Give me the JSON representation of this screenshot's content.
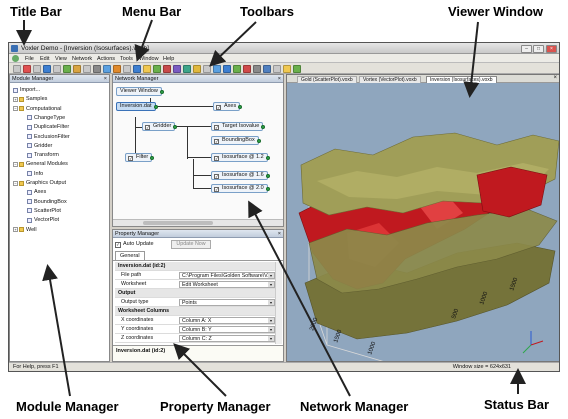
{
  "annotations": {
    "title_bar": "Title Bar",
    "menu_bar": "Menu Bar",
    "toolbars": "Toolbars",
    "viewer_window": "Viewer Window",
    "module_manager": "Module Manager",
    "property_manager": "Property Manager",
    "network_manager": "Network Manager",
    "status_bar": "Status Bar"
  },
  "window": {
    "title": "Voxler Demo - [Inversion (Isosurfaces).voxb]",
    "controls": [
      "–",
      "□",
      "×"
    ]
  },
  "menu": [
    "File",
    "Edit",
    "View",
    "Network",
    "Actions",
    "Tools",
    "Window",
    "Help"
  ],
  "toolbar_colors": [
    "#c8c8c8",
    "#e05050",
    "#c8c8c8",
    "#3d7fd1",
    "#c8c8c8",
    "#6ab04c",
    "#d9a441",
    "#c8c8c8",
    "#8a8a8a",
    "#5aa0e0",
    "#e08a2b",
    "#c8c8c8",
    "#3d7fd1",
    "#f0c850",
    "#6ab04c",
    "#c84a4a",
    "#7a5bc2",
    "#3da58a",
    "#e0b83d",
    "#c8c8c8",
    "#5aa0e0",
    "#3d7fd1",
    "#6ab04c",
    "#d04a4a",
    "#8a8a8a",
    "#5080c0",
    "#c8c8c8",
    "#f0c850",
    "#6ab04c"
  ],
  "module_manager": {
    "title": "Module Manager",
    "items": [
      {
        "label": "Import...",
        "level": 0,
        "kind": "doc"
      },
      {
        "label": "Samples",
        "level": 0,
        "kind": "folder",
        "exp": "+"
      },
      {
        "label": "Computational",
        "level": 0,
        "kind": "folder",
        "exp": "−"
      },
      {
        "label": "ChangeType",
        "level": 1,
        "kind": "doc"
      },
      {
        "label": "DuplicateFilter",
        "level": 1,
        "kind": "doc"
      },
      {
        "label": "ExclusionFilter",
        "level": 1,
        "kind": "doc"
      },
      {
        "label": "Gridder",
        "level": 1,
        "kind": "doc"
      },
      {
        "label": "Transform",
        "level": 1,
        "kind": "doc"
      },
      {
        "label": "General Modules",
        "level": 0,
        "kind": "folder",
        "exp": "−"
      },
      {
        "label": "Info",
        "level": 1,
        "kind": "doc"
      },
      {
        "label": "Graphics Output",
        "level": 0,
        "kind": "folder",
        "exp": "−"
      },
      {
        "label": "Axes",
        "level": 1,
        "kind": "doc"
      },
      {
        "label": "BoundingBox",
        "level": 1,
        "kind": "doc"
      },
      {
        "label": "ScatterPlot",
        "level": 1,
        "kind": "doc"
      },
      {
        "label": "VectorPlot",
        "level": 1,
        "kind": "doc"
      },
      {
        "label": "Well",
        "level": 0,
        "kind": "folder",
        "exp": "+"
      }
    ]
  },
  "network_manager": {
    "title": "Network Manager",
    "nodes": {
      "viewer": "Viewer Window",
      "inversion": "Inversion.dat",
      "axes": "Axes",
      "gridder": "Gridder",
      "target": "Target Isovalue",
      "bbox": "BoundingBox",
      "filter": "Filter",
      "iso12": "Isosurface @ 1.2",
      "iso16": "Isosurface @ 1.6",
      "iso20": "Isosurface @ 2.0"
    }
  },
  "property_manager": {
    "title": "Property Manager",
    "auto_update": "Auto Update",
    "update_now": "Update Now",
    "tab": "General",
    "rows": [
      {
        "type": "section",
        "key": "Inversion.dat (id:2)"
      },
      {
        "type": "field",
        "key": "File path",
        "value": "C:\\Program Files\\Golden Software\\V..."
      },
      {
        "type": "field",
        "key": "Worksheet",
        "value": "Edit Worksheet"
      },
      {
        "type": "section",
        "key": "Output"
      },
      {
        "type": "field",
        "key": "Output type",
        "value": "Points"
      },
      {
        "type": "section",
        "key": "Worksheet Columns"
      },
      {
        "type": "field",
        "key": "X coordinates",
        "value": "Column A: X"
      },
      {
        "type": "field",
        "key": "Y coordinates",
        "value": "Column B: Y"
      },
      {
        "type": "field",
        "key": "Z coordinates",
        "value": "Column C: Z"
      }
    ],
    "footer": "Inversion.dat (id:2)"
  },
  "viewer": {
    "tabs": [
      "Gold (ScatterPlot).voxb",
      "Vortex (VectorPlot).voxb",
      "Inversion (Isosurfaces).voxb"
    ],
    "axis_ticks_left": [
      "2000",
      "1500",
      "1000"
    ],
    "axis_ticks_right": [
      "500",
      "1000",
      "1500"
    ],
    "background": "#8fa6be"
  },
  "status": {
    "left": "For Help, press F1",
    "right": "Window size = 624x631"
  }
}
